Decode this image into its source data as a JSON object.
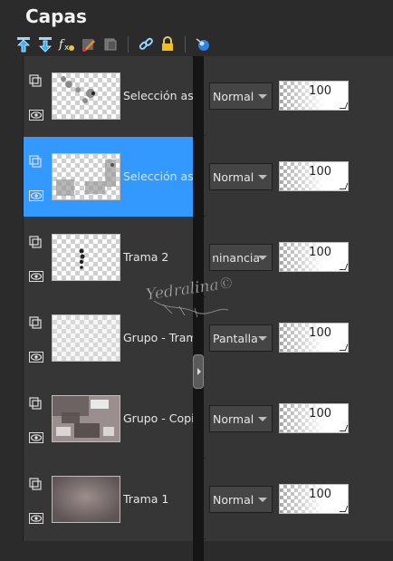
{
  "panel": {
    "title": "Capas"
  },
  "toolbar": {
    "items": [
      {
        "icon": "move-layer-up-icon"
      },
      {
        "icon": "move-layer-down-icon"
      },
      {
        "icon": "effects-fx-icon"
      },
      {
        "icon": "paint-brush-icon"
      },
      {
        "icon": "duplicate-layer-icon"
      },
      {
        "icon": "link-chain-icon"
      },
      {
        "icon": "lock-icon"
      },
      {
        "icon": "globe-icon"
      }
    ]
  },
  "layers": [
    {
      "name": "Selección ascendida",
      "blend": "Normal",
      "opacity": "100",
      "selected": false,
      "thumb": "selection1"
    },
    {
      "name": "Selección ascendida",
      "blend": "Normal",
      "opacity": "100",
      "selected": true,
      "thumb": "selection2"
    },
    {
      "name": "Trama 2",
      "blend": "Luminancia",
      "opacity": "100",
      "selected": false,
      "thumb": "trama2"
    },
    {
      "name": "Grupo - Trama",
      "blend": "Pantalla",
      "opacity": "100",
      "selected": false,
      "thumb": "grupo1"
    },
    {
      "name": "Grupo - Copia",
      "blend": "Normal",
      "opacity": "100",
      "selected": false,
      "thumb": "grupo2"
    },
    {
      "name": "Trama 1",
      "blend": "Normal",
      "opacity": "100",
      "selected": false,
      "thumb": "trama1"
    }
  ],
  "colors": {
    "selected": "#3399ff",
    "panel_bg": "#2b2b2b",
    "row_bg": "#363636"
  },
  "watermark": {
    "text": "Yedralina"
  }
}
